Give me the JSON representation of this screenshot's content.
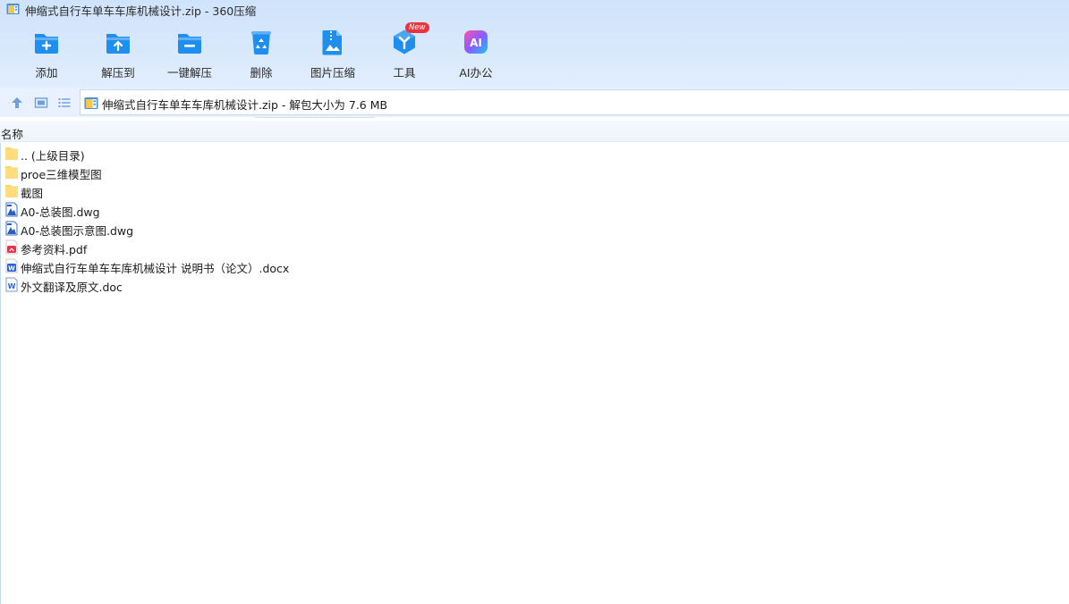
{
  "window": {
    "title": "伸缩式自行车单车车库机械设计.zip - 360压缩"
  },
  "toolbar": {
    "items": [
      {
        "label": "添加",
        "icon": "add-folder-icon"
      },
      {
        "label": "解压到",
        "icon": "extract-to-icon"
      },
      {
        "label": "一键解压",
        "icon": "one-click-extract-icon"
      },
      {
        "label": "删除",
        "icon": "recycle-bin-icon"
      },
      {
        "label": "图片压缩",
        "icon": "image-compress-icon"
      },
      {
        "label": "工具",
        "icon": "tools-icon",
        "badge": "New"
      },
      {
        "label": "AI办公",
        "icon": "ai-office-icon",
        "icon_text": "AI"
      }
    ]
  },
  "address": {
    "path": "伸缩式自行车单车车库机械设计.zip - 解包大小为 7.6 MB"
  },
  "columns": {
    "name": "名称"
  },
  "files": [
    {
      "name": ".. (上级目录)",
      "type": "folder"
    },
    {
      "name": "proe三维模型图",
      "type": "folder"
    },
    {
      "name": "截图",
      "type": "folder"
    },
    {
      "name": "A0-总装图.dwg",
      "type": "dwg"
    },
    {
      "name": "A0-总装图示意图.dwg",
      "type": "dwg"
    },
    {
      "name": "参考资料.pdf",
      "type": "pdf"
    },
    {
      "name": "伸缩式自行车单车车库机械设计 说明书（论文）.docx",
      "type": "word"
    },
    {
      "name": "外文翻译及原文.doc",
      "type": "doc"
    }
  ],
  "colors": {
    "accent": "#1e8ef0",
    "header_bg": "#d9e9fc",
    "folder": "#ffd46a",
    "pdf": "#e8364a",
    "word": "#2b62d9",
    "badge": "#f0323c"
  }
}
